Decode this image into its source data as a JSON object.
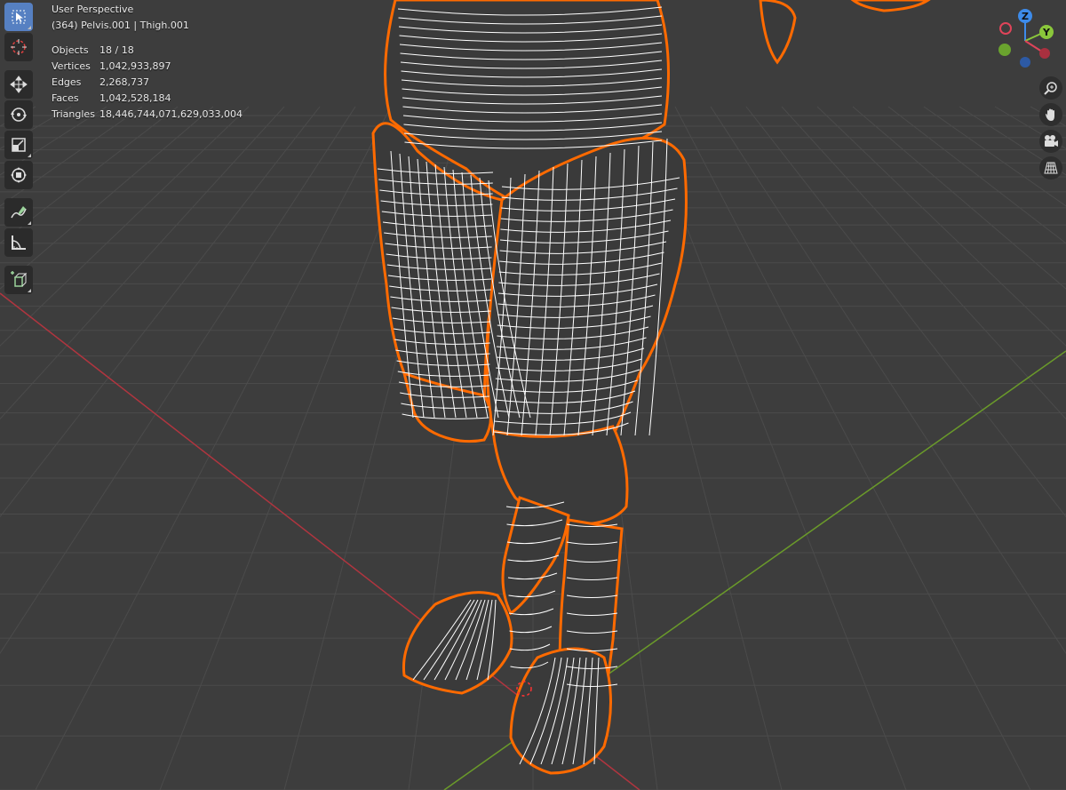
{
  "overlay": {
    "view_name": "User Perspective",
    "context": "(364) Pelvis.001 | Thigh.001",
    "stats": [
      {
        "label": "Objects",
        "value": "18 / 18"
      },
      {
        "label": "Vertices",
        "value": "1,042,933,897"
      },
      {
        "label": "Edges",
        "value": "2,268,737"
      },
      {
        "label": "Faces",
        "value": "1,042,528,184"
      },
      {
        "label": "Triangles",
        "value": "18,446,744,071,629,033,004"
      }
    ]
  },
  "toolbar": {
    "tools": [
      {
        "name": "select-tool",
        "icon": "cursor-arrow-icon",
        "active": true
      },
      {
        "name": "cursor-tool",
        "icon": "3d-cursor-icon",
        "active": false
      },
      {
        "name": "move-tool",
        "icon": "move-arrows-icon",
        "active": false
      },
      {
        "name": "rotate-tool",
        "icon": "rotate-icon",
        "active": false
      },
      {
        "name": "scale-tool",
        "icon": "scale-icon",
        "active": false
      },
      {
        "name": "transform-tool",
        "icon": "transform-icon",
        "active": false
      },
      {
        "name": "annotate-tool",
        "icon": "annotate-pen-icon",
        "active": false
      },
      {
        "name": "measure-tool",
        "icon": "measure-ruler-icon",
        "active": false
      },
      {
        "name": "add-cube-tool",
        "icon": "add-cube-icon",
        "active": false
      }
    ]
  },
  "gizmo": {
    "z_label": "Z",
    "y_label": "Y",
    "x_color": "#e0445a",
    "y_color": "#8ac73b",
    "z_color": "#3d8bea"
  },
  "nav_buttons": [
    {
      "name": "zoom-button",
      "icon": "zoom-magnifier-icon"
    },
    {
      "name": "pan-button",
      "icon": "hand-pan-icon"
    },
    {
      "name": "camera-view-button",
      "icon": "camera-icon"
    },
    {
      "name": "perspective-toggle-button",
      "icon": "grid-perspective-icon"
    }
  ],
  "colors": {
    "background": "#3d3d3d",
    "grid": "#4a4a4a",
    "x_axis": "#b0353f",
    "y_axis": "#6a9a2a",
    "wire": "#ffffff",
    "selection_outline": "#ff6a00",
    "active_tool": "#5680c2"
  }
}
